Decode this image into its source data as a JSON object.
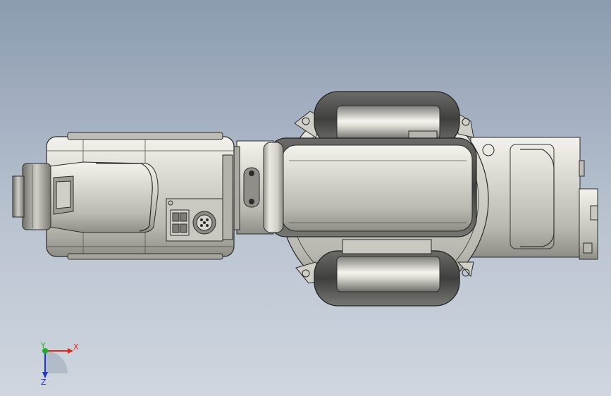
{
  "viewport": {
    "background_top": "#8c9bb0",
    "background_bottom": "#cfd6df"
  },
  "model": {
    "body_color": "#d4d3cb",
    "edge_color": "#2b2b2b",
    "dark_color": "#5a5a58"
  },
  "triad": {
    "x_label": "X",
    "y_label": "Y",
    "z_label": "Z",
    "x_color": "#e0271c",
    "y_color": "#1fb02a",
    "z_color": "#2434c8"
  }
}
